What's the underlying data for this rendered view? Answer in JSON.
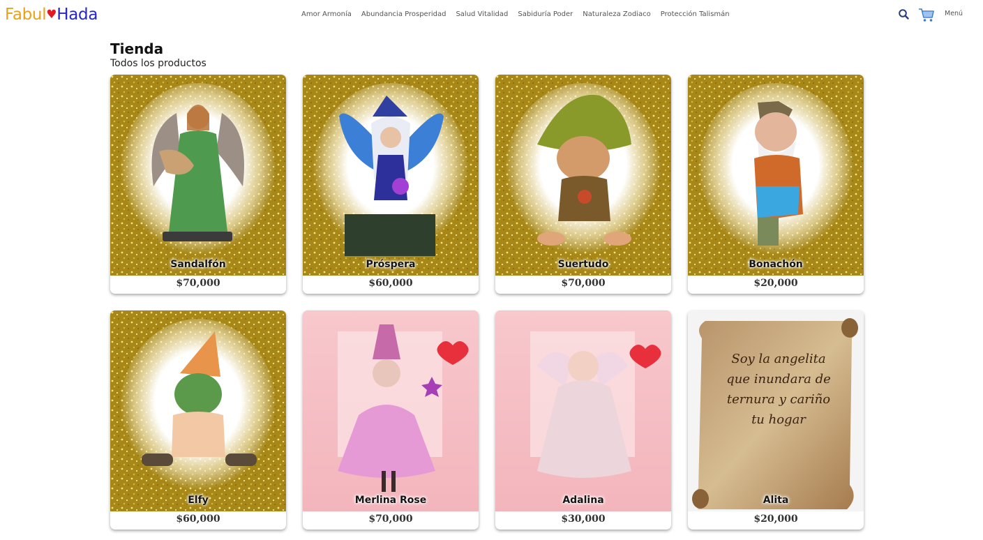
{
  "brand": {
    "part1": "Fabul",
    "heart": "♥",
    "part2": "Hada"
  },
  "nav": [
    "Amor Armonía",
    "Abundancia Prosperidad",
    "Salud Vitalidad",
    "Sabiduría Poder",
    "Naturaleza Zodiaco",
    "Protección Talismán"
  ],
  "header": {
    "search_icon": "search-icon",
    "cart_icon": "cart-icon",
    "menu_label": "Menú"
  },
  "page": {
    "title": "Tienda",
    "subtitle": "Todos los productos"
  },
  "colors": {
    "brand_orange": "#e8a21a",
    "brand_blue": "#2626c9",
    "brand_red": "#e01b24",
    "glitter_gold": "#b8961e",
    "card_pink": "#f6c3c8"
  },
  "products": [
    {
      "name": "Sandalfón",
      "price": "$70,000",
      "background": "gold-glitter",
      "figure": "green angel figurine"
    },
    {
      "name": "Próspera",
      "price": "$60,000",
      "background": "gold-glitter",
      "figure": "blue fairy doll"
    },
    {
      "name": "Suertudo",
      "price": "$70,000",
      "background": "gold-glitter",
      "figure": "green hat goblin"
    },
    {
      "name": "Bonachón",
      "price": "$20,000",
      "background": "gold-glitter",
      "figure": "dwarf figurine"
    },
    {
      "name": "Elfy",
      "price": "$60,000",
      "background": "gold-glitter",
      "figure": "elf figurine"
    },
    {
      "name": "Merlina Rose",
      "price": "$70,000",
      "background": "pink-hearts",
      "figure": "pink witch doll"
    },
    {
      "name": "Adalina",
      "price": "$30,000",
      "background": "pink-hearts",
      "figure": "pink angel figurine"
    },
    {
      "name": "Alita",
      "price": "$20,000",
      "background": "parchment-scroll",
      "figure": "scroll",
      "scroll_lines": [
        "Soy la angelita",
        "que inundara de",
        "ternura y cariño",
        "tu hogar"
      ]
    }
  ]
}
